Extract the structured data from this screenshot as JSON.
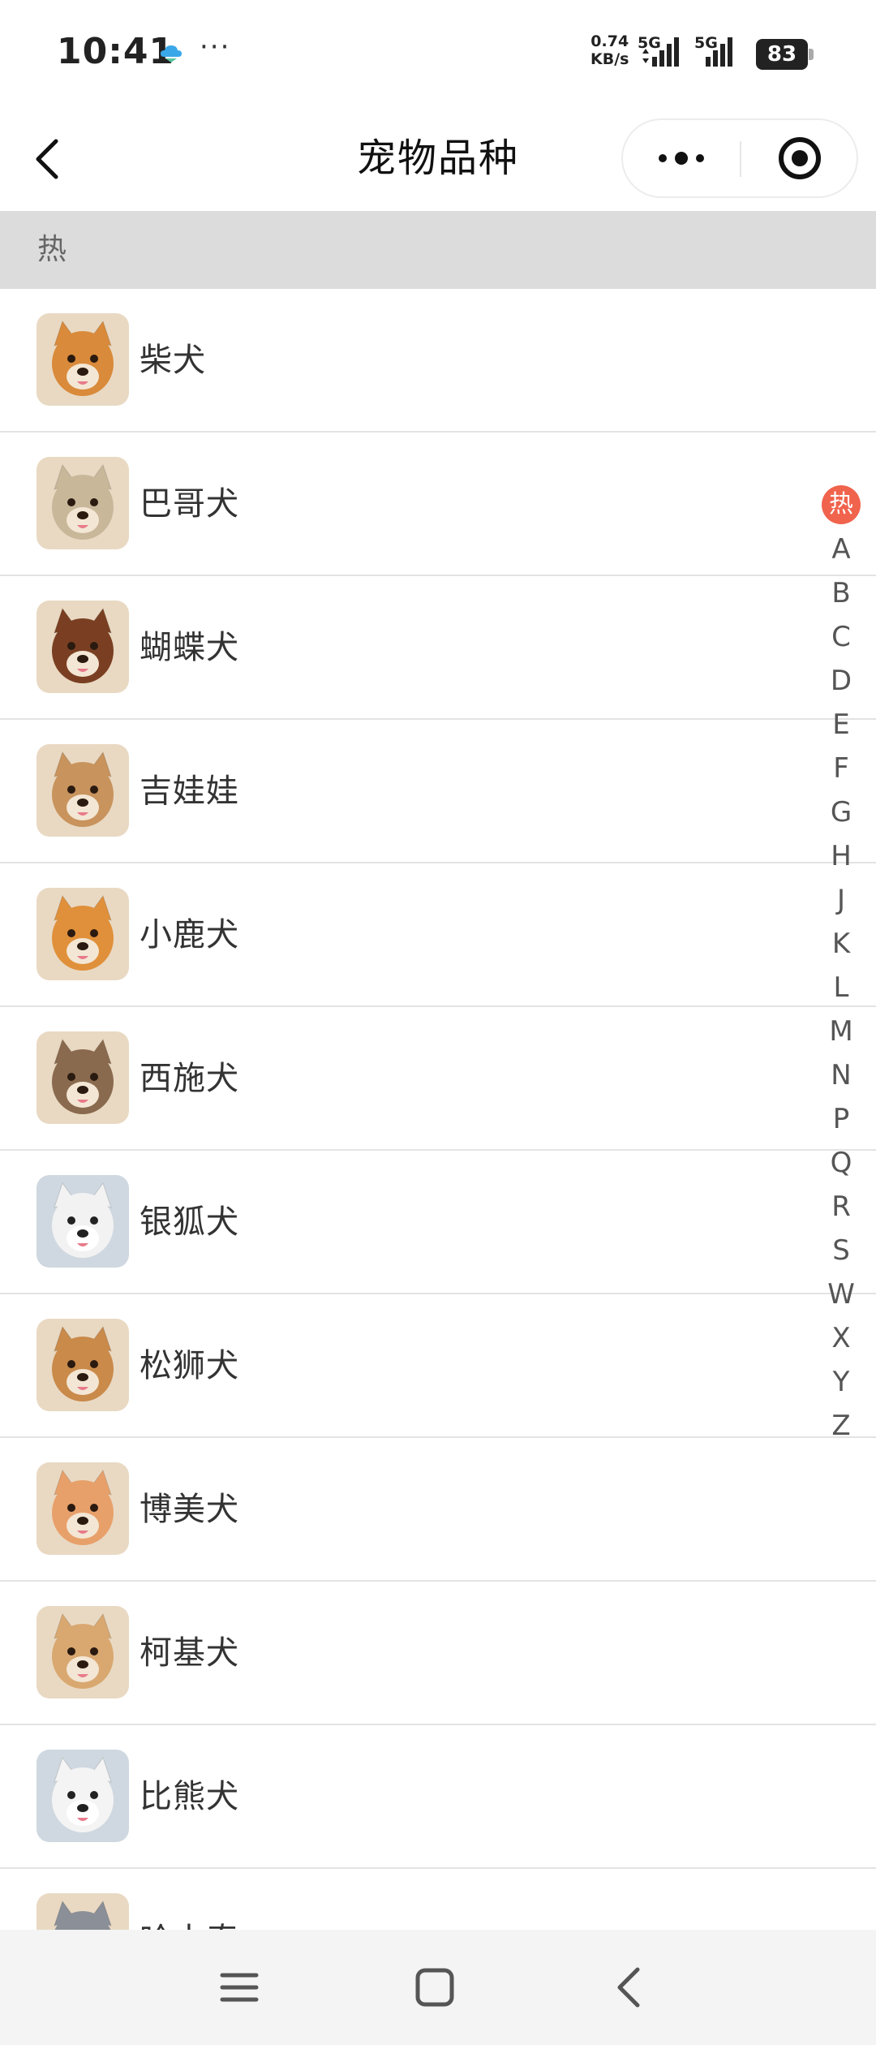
{
  "status_bar": {
    "time": "10:41",
    "dots": "···",
    "net_speed_value": "0.74",
    "net_speed_unit": "KB/s",
    "sim1_label": "5G",
    "sim2_label": "5G",
    "battery_level": "83"
  },
  "nav": {
    "title": "宠物品种"
  },
  "section": {
    "hot_label": "热"
  },
  "breeds": [
    {
      "name": "柴犬",
      "color": "#d98a3a"
    },
    {
      "name": "巴哥犬",
      "color": "#c9b79a"
    },
    {
      "name": "蝴蝶犬",
      "color": "#7a3f22"
    },
    {
      "name": "吉娃娃",
      "color": "#c8935c"
    },
    {
      "name": "小鹿犬",
      "color": "#e0903a"
    },
    {
      "name": "西施犬",
      "color": "#8a6a4e"
    },
    {
      "name": "银狐犬",
      "color": "#f2f2f2"
    },
    {
      "name": "松狮犬",
      "color": "#c98a4a"
    },
    {
      "name": "博美犬",
      "color": "#e8a06a"
    },
    {
      "name": "柯基犬",
      "color": "#d9a870"
    },
    {
      "name": "比熊犬",
      "color": "#f4f4f4"
    },
    {
      "name": "哈士奇",
      "color": "#8a8f98"
    }
  ],
  "index": {
    "hot": "热",
    "letters": [
      "A",
      "B",
      "C",
      "D",
      "E",
      "F",
      "G",
      "H",
      "J",
      "K",
      "L",
      "M",
      "N",
      "P",
      "Q",
      "R",
      "S",
      "W",
      "X",
      "Y",
      "Z"
    ]
  },
  "icons": {
    "back": "chevron-left-icon",
    "more": "more-dots-icon",
    "close": "target-circle-icon",
    "menu": "menu-icon",
    "home": "home-square-icon",
    "sys_back": "back-icon"
  },
  "colors": {
    "accent": "#f0634c",
    "section_bg": "#dcdcdc",
    "divider": "#e3e3e3"
  }
}
